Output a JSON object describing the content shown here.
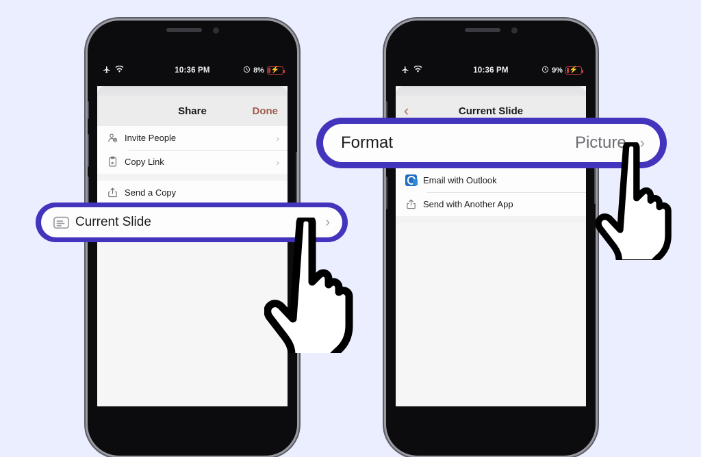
{
  "colors": {
    "background": "#eaeeff",
    "accent_purple": "#4334bd",
    "sheet": "#fdfdfd",
    "done_link": "#a05a4e",
    "back_chevron": "#b5705e",
    "outlook_blue": "#1f6fc4",
    "battery_red": "#c23b3b"
  },
  "left_phone": {
    "status_bar": {
      "airplane_icon": "airplane-icon",
      "wifi_icon": "wifi-icon",
      "time": "10:36 PM",
      "alarm_icon": "alarm-icon",
      "battery_percent": "8%",
      "charging_icon": "charging-bolt-icon"
    },
    "navbar": {
      "title": "Share",
      "done_label": "Done"
    },
    "list": [
      {
        "icon": "invite-person-icon",
        "label": "Invite People",
        "chevron": "›"
      },
      {
        "icon": "clipboard-link-icon",
        "label": "Copy Link",
        "chevron": "›"
      },
      {
        "icon": "share-up-arrow-icon",
        "label": "Send a Copy",
        "chevron": ""
      }
    ],
    "callout": {
      "icon": "slide-icon",
      "label": "Current Slide",
      "chevron": "›"
    }
  },
  "right_phone": {
    "status_bar": {
      "airplane_icon": "airplane-icon",
      "wifi_icon": "wifi-icon",
      "time": "10:36 PM",
      "alarm_icon": "alarm-icon",
      "battery_percent": "9%",
      "charging_icon": "charging-bolt-icon"
    },
    "navbar": {
      "back": "‹",
      "title": "Current Slide"
    },
    "list": [
      {
        "icon": "outlook-icon",
        "label": "Email with Outlook",
        "chevron": ""
      },
      {
        "icon": "share-up-arrow-icon",
        "label": "Send with Another App",
        "chevron": ""
      }
    ],
    "callout": {
      "label": "Format",
      "value": "Picture",
      "chevron": "›"
    }
  },
  "cursors": [
    {
      "name": "hand-pointer-cursor-left"
    },
    {
      "name": "hand-pointer-cursor-right"
    }
  ]
}
